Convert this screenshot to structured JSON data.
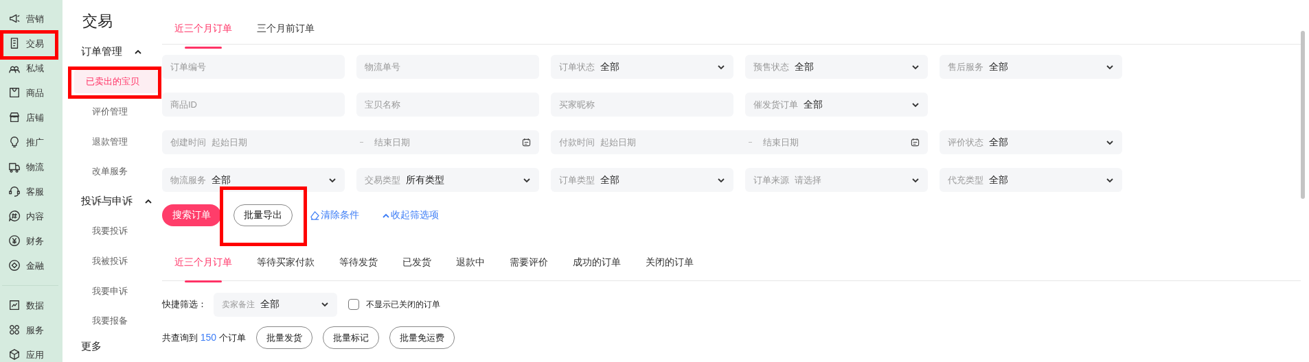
{
  "sidebar": {
    "groups": [
      [
        {
          "label": "营销",
          "highlighted": false
        },
        {
          "label": "交易",
          "highlighted": true
        },
        {
          "label": "私域",
          "highlighted": false
        },
        {
          "label": "商品",
          "highlighted": false
        },
        {
          "label": "店铺",
          "highlighted": false
        },
        {
          "label": "推广",
          "highlighted": false
        },
        {
          "label": "物流",
          "highlighted": false
        },
        {
          "label": "客服",
          "highlighted": false
        },
        {
          "label": "内容",
          "highlighted": false
        },
        {
          "label": "财务",
          "highlighted": false
        },
        {
          "label": "金融",
          "highlighted": false
        }
      ],
      [
        {
          "label": "数据",
          "highlighted": false
        },
        {
          "label": "服务",
          "highlighted": false
        },
        {
          "label": "应用",
          "highlighted": false
        }
      ]
    ]
  },
  "subnav": {
    "title": "交易",
    "sections": [
      {
        "label": "订单管理",
        "expanded": true,
        "items": [
          {
            "label": "已卖出的宝贝",
            "selected": true,
            "highlighted": true
          },
          {
            "label": "评价管理",
            "selected": false,
            "highlighted": false
          },
          {
            "label": "退款管理",
            "selected": false,
            "highlighted": false
          },
          {
            "label": "改单服务",
            "selected": false,
            "highlighted": false
          }
        ]
      },
      {
        "label": "投诉与申诉",
        "expanded": true,
        "items": [
          {
            "label": "我要投诉",
            "selected": false,
            "highlighted": false
          },
          {
            "label": "我被投诉",
            "selected": false,
            "highlighted": false
          },
          {
            "label": "我要申诉",
            "selected": false,
            "highlighted": false
          },
          {
            "label": "我要报备",
            "selected": false,
            "highlighted": false
          }
        ]
      },
      {
        "label": "更多"
      }
    ]
  },
  "tabs": [
    {
      "label": "近三个月订单",
      "selected": true
    },
    {
      "label": "三个月前订单",
      "selected": false
    }
  ],
  "filters": [
    [
      {
        "kind": "text",
        "placeholder": "订单编号"
      },
      {
        "kind": "text",
        "placeholder": "物流单号"
      },
      {
        "kind": "select",
        "label": "订单状态",
        "value": "全部"
      },
      {
        "kind": "select",
        "label": "预售状态",
        "value": "全部"
      },
      {
        "kind": "select",
        "label": "售后服务",
        "value": "全部"
      }
    ],
    [
      {
        "kind": "text",
        "placeholder": "商品ID"
      },
      {
        "kind": "text",
        "placeholder": "宝贝名称"
      },
      {
        "kind": "text",
        "placeholder": "买家昵称"
      },
      {
        "kind": "select",
        "label": "催发货订单",
        "value": "全部"
      }
    ],
    [
      {
        "kind": "daterange",
        "label": "创建时间",
        "start_placeholder": "起始日期",
        "end_placeholder": "结束日期"
      },
      {
        "kind": "daterange",
        "label": "付款时间",
        "start_placeholder": "起始日期",
        "end_placeholder": "结束日期"
      },
      {
        "kind": "select",
        "label": "评价状态",
        "value": "全部"
      }
    ],
    [
      {
        "kind": "select",
        "label": "物流服务",
        "value": "全部"
      },
      {
        "kind": "select",
        "label": "交易类型",
        "value": "所有类型"
      },
      {
        "kind": "select",
        "label": "订单类型",
        "value": "全部"
      },
      {
        "kind": "select",
        "label": "订单来源",
        "placeholder": "请选择"
      },
      {
        "kind": "select",
        "label": "代充类型",
        "value": "全部"
      }
    ]
  ],
  "actions": [
    {
      "kind": "primary",
      "label": "搜索订单",
      "highlighted": false
    },
    {
      "kind": "outline",
      "label": "批量导出",
      "highlighted": true
    },
    {
      "kind": "clear",
      "label": "清除条件",
      "highlighted": false
    },
    {
      "kind": "collapse",
      "label": "收起筛选项",
      "highlighted": false
    }
  ],
  "status_tabs": [
    {
      "label": "近三个月订单",
      "selected": true
    },
    {
      "label": "等待买家付款",
      "selected": false
    },
    {
      "label": "等待发货",
      "selected": false
    },
    {
      "label": "已发货",
      "selected": false
    },
    {
      "label": "退款中",
      "selected": false
    },
    {
      "label": "需要评价",
      "selected": false
    },
    {
      "label": "成功的订单",
      "selected": false
    },
    {
      "label": "关闭的订单",
      "selected": false
    }
  ],
  "quick_filter": {
    "label": "快捷筛选：",
    "select": {
      "label": "卖家备注",
      "value": "全部"
    },
    "checkbox": {
      "label": "不显示已关闭的订单",
      "checked": false
    }
  },
  "summary": {
    "prefix": "共查询到",
    "count": "150",
    "suffix": "个订单",
    "buttons": [
      "批量发货",
      "批量标记",
      "批量免运费"
    ]
  }
}
